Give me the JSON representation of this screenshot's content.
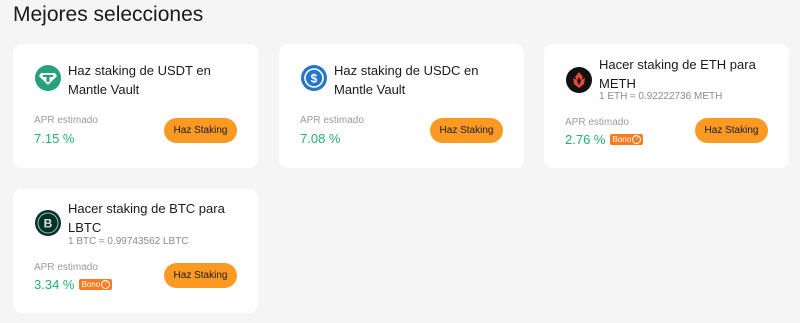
{
  "heading": "Mejores selecciones",
  "cards": [
    {
      "title": "Haz staking de USDT en Mantle Vault",
      "apr_label": "APR estimado",
      "apr_value": "7.15 %",
      "button_label": "Haz Staking",
      "icon": "usdt-icon",
      "icon_color": "#26a17b"
    },
    {
      "title": "Haz staking de USDC en Mantle Vault",
      "apr_label": "APR estimado",
      "apr_value": "7.08 %",
      "button_label": "Haz Staking",
      "icon": "usdc-icon",
      "icon_color": "#2775ca"
    },
    {
      "title": "Hacer staking de ETH para METH",
      "rate": "1 ETH ≈ 0.92222736 METH",
      "apr_label": "APR estimado",
      "apr_value": "2.76 %",
      "badge": "Bono",
      "button_label": "Haz Staking",
      "icon": "meth-icon",
      "icon_color": "#111111"
    },
    {
      "title": "Hacer staking de BTC para LBTC",
      "rate": "1 BTC ≈ 0.99743562 LBTC",
      "apr_label": "APR estimado",
      "apr_value": "3.34 %",
      "badge": "Bono",
      "button_label": "Haz Staking",
      "icon": "lbtc-icon",
      "icon_color": "#0f2a27"
    }
  ],
  "colors": {
    "accent_button": "#fa9a23",
    "apr_green": "#20b26c",
    "badge_orange": "#ff7a1f"
  }
}
